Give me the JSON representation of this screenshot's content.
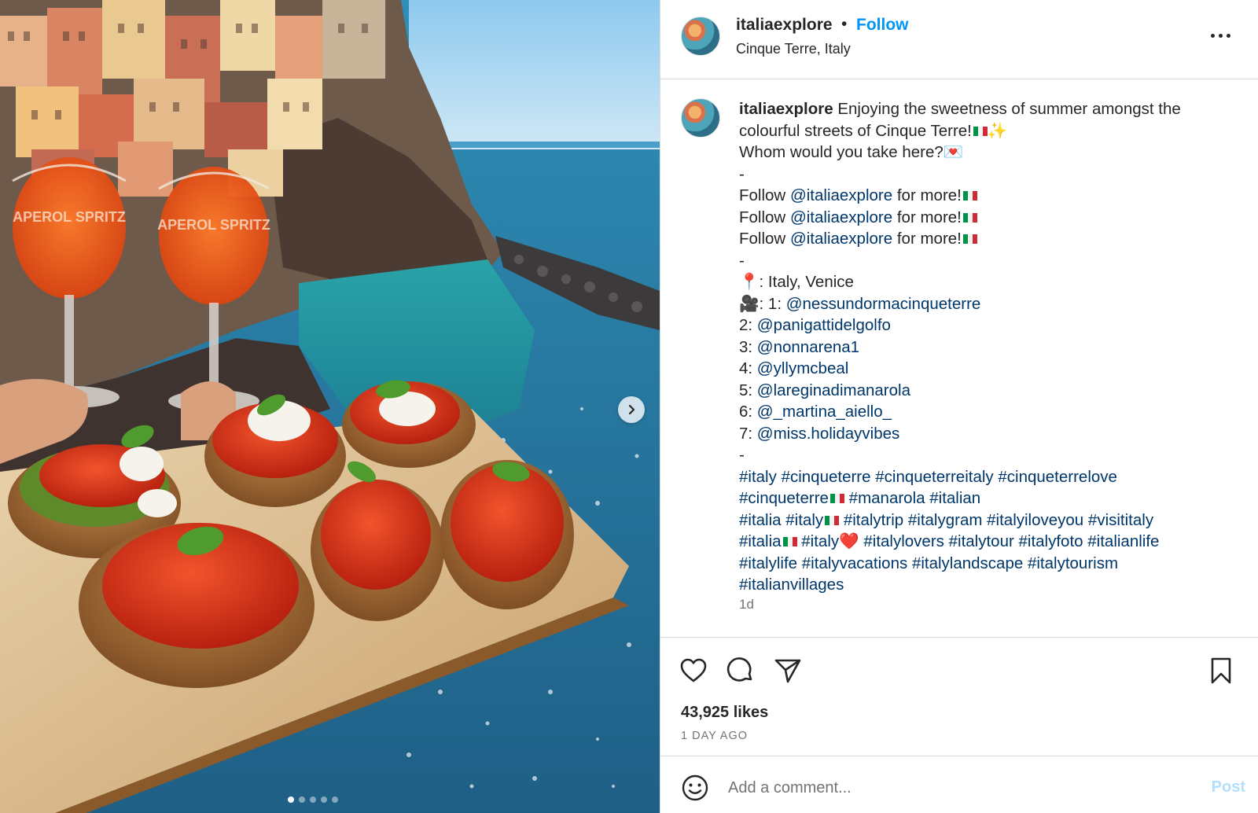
{
  "media": {
    "image_label": "Bruschetta and Aperol Spritz glasses overlooking Manarola, Cinque Terre",
    "glass_text": "APEROL SPRITZ",
    "carousel_count": 5,
    "carousel_active": 1
  },
  "header": {
    "username": "italiaexplore",
    "separator": "•",
    "follow_label": "Follow",
    "location": "Cinque Terre, Italy"
  },
  "caption": {
    "username": "italiaexplore",
    "lines": {
      "l1": "Enjoying the sweetness of summer amongst the",
      "l2": "colourful streets of Cinque Terre!",
      "l2_sparkle": "✨",
      "l3": "Whom would you take here?",
      "l3_emoji": "💌",
      "dash1": "-",
      "follow_prefix": "Follow ",
      "follow_handle": "@italiaexplore",
      "follow_suffix": " for more!",
      "dash2": "-",
      "pin": "📍",
      "location_line": ": Italy, Venice",
      "camera": "🎥",
      "credit1_prefix": ": 1: ",
      "credit1": "@nessundormacinqueterre",
      "credit2_prefix": "2: ",
      "credit2": "@panigattidelgolfo",
      "credit3_prefix": "3: ",
      "credit3": "@nonnarena1",
      "credit4_prefix": "4: ",
      "credit4": "@yllymcbeal",
      "credit5_prefix": "5: ",
      "credit5": "@lareginadimanarola",
      "credit6_prefix": "6: ",
      "credit6": "@_martina_aiello_",
      "credit7_prefix": "7: ",
      "credit7": "@miss.holidayvibes",
      "dash3": "-"
    },
    "hashtags": {
      "h1": "#italy",
      "h2": "#cinqueterre",
      "h3": "#cinqueterreitaly",
      "h4": "#cinqueterrelove",
      "h5": "#cinqueterre",
      "h6": "#manarola",
      "h7": "#italian",
      "h8": "#italia",
      "h9": "#italy",
      "h10": "#italytrip",
      "h11": "#italygram",
      "h12": "#italyiloveyou",
      "h13": "#visititaly",
      "h14": "#italia",
      "h15": "#italy",
      "h15_heart": "❤️",
      "h16": "#italylovers",
      "h17": "#italytour",
      "h18": "#italyfoto",
      "h19": "#italianlife",
      "h20": "#italylife",
      "h21": "#italyvacations",
      "h22": "#italylandscape",
      "h23": "#italytourism",
      "h24": "#italianvillages"
    },
    "time_small": "1d"
  },
  "actions": {
    "likes": "43,925 likes",
    "date": "1 DAY AGO"
  },
  "comment": {
    "placeholder": "Add a comment...",
    "post_label": "Post"
  },
  "colors": {
    "accent": "#0095f6",
    "link": "#00376b",
    "muted": "#737373",
    "border": "#dbdbdb",
    "post_disabled": "#b2dffc"
  },
  "icons": [
    "chevron-right-icon",
    "heart-icon",
    "comment-icon",
    "share-icon",
    "bookmark-icon",
    "emoji-icon",
    "more-icon"
  ]
}
